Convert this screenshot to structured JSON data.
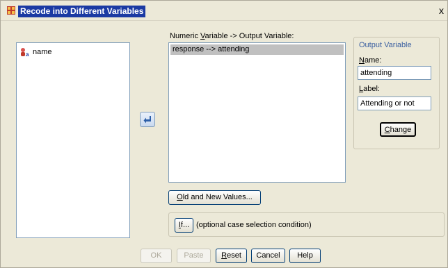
{
  "window": {
    "title": "Recode into Different Variables",
    "close_label": "x"
  },
  "source_list": {
    "items": [
      {
        "label": "name",
        "icon": "string-variable-icon"
      }
    ]
  },
  "numeric_output": {
    "label_prefix": "Numeric ",
    "label_mnemonic": "V",
    "label_suffix": "ariable -> Output Variable:",
    "items": [
      {
        "label": "response --> attending",
        "selected": true
      }
    ]
  },
  "output_variable": {
    "group_title": "Output Variable",
    "name_label_mnemonic": "N",
    "name_label_rest": "ame:",
    "name_value": "attending",
    "label_label_mnemonic": "L",
    "label_label_rest": "abel:",
    "label_value": "Attending or not",
    "change_label_mnemonic": "C",
    "change_label_rest": "hange"
  },
  "buttons": {
    "old_new_mnemonic": "O",
    "old_new_rest": "ld and New Values...",
    "if_mnemonic": "I",
    "if_rest": "f...",
    "if_condition_text": "(optional case selection condition)",
    "ok": "OK",
    "paste": "Paste",
    "reset_mnemonic": "R",
    "reset_rest": "eset",
    "cancel": "Cancel",
    "help": "Help"
  },
  "colors": {
    "selection_bg": "#c0c0c0",
    "title_highlight": "#1b3aa3",
    "arrow_button": "#4f81c7"
  }
}
